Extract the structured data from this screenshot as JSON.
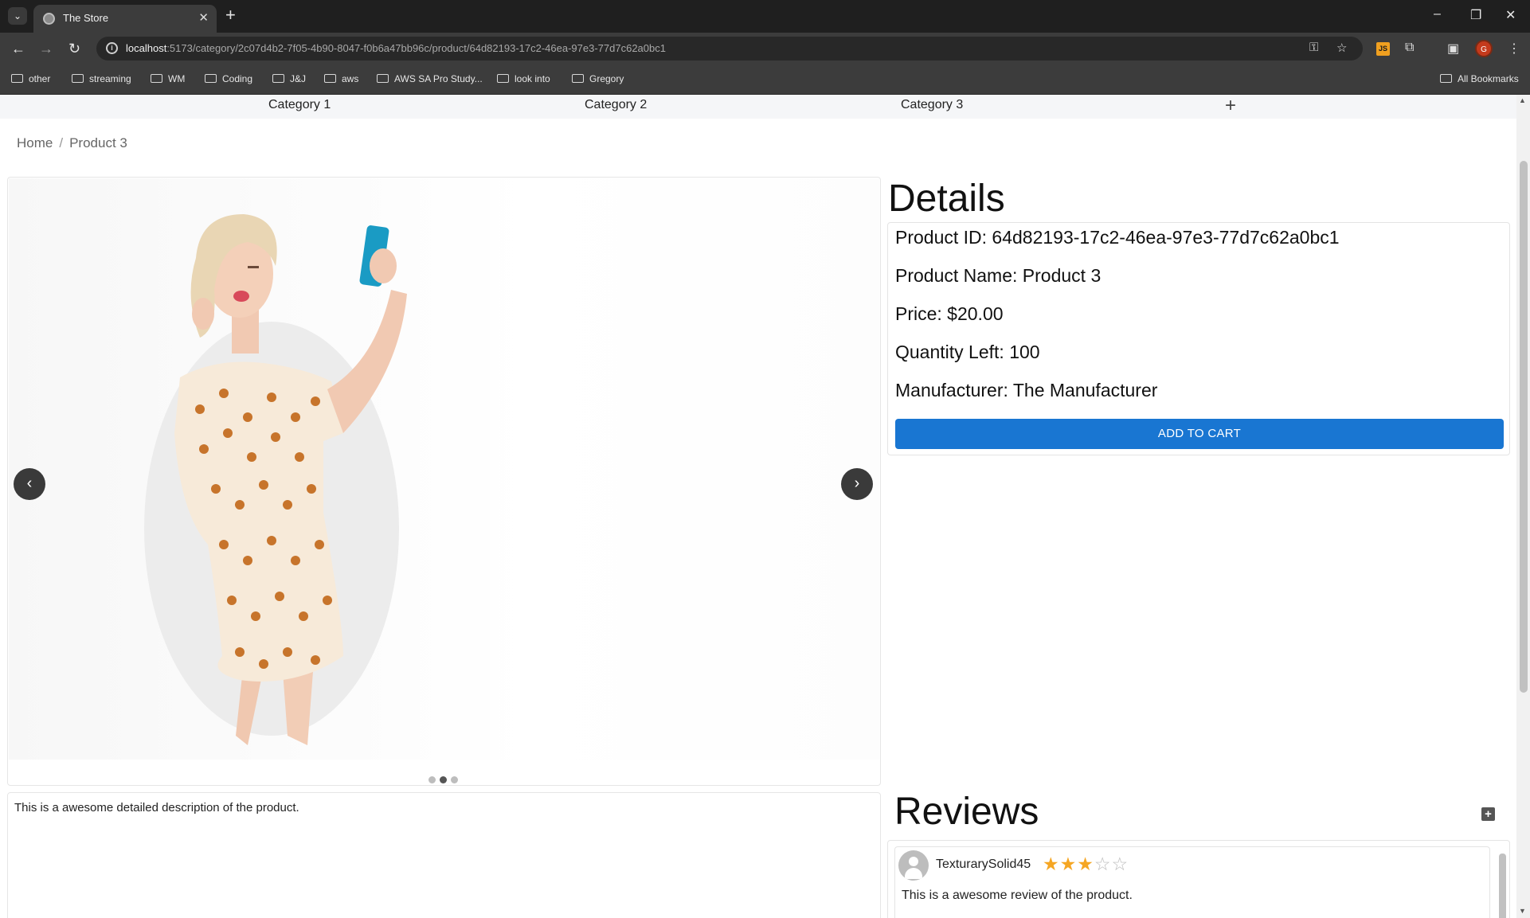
{
  "browser": {
    "tab_title": "The Store",
    "url_host": "localhost",
    "url_rest": ":5173/category/2c07d4b2-7f05-4b90-8047-f0b6a47bb96c/product/64d82193-17c2-46ea-97e3-77d7c62a0bc1",
    "profile_initial": "G",
    "ext_label": "JS",
    "bookmarks": [
      "other",
      "streaming",
      "WM",
      "Coding",
      "J&J",
      "aws",
      "AWS SA Pro Study...",
      "look into",
      "Gregory"
    ],
    "all_bookmarks": "All Bookmarks"
  },
  "nav": {
    "categories": [
      "Category 1",
      "Category 2",
      "Category 3"
    ],
    "add_icon": "plus-icon"
  },
  "breadcrumb": {
    "home": "Home",
    "separator": "/",
    "current": "Product 3"
  },
  "carousel": {
    "prev_icon": "chevron-left-icon",
    "next_icon": "chevron-right-icon",
    "slide_count": 3,
    "active_index": 1
  },
  "description": "This is a awesome detailed description of the product.",
  "details": {
    "title": "Details",
    "product_id": "Product ID: 64d82193-17c2-46ea-97e3-77d7c62a0bc1",
    "product_name": "Product Name: Product 3",
    "price": "Price: $20.00",
    "quantity": "Quantity Left: 100",
    "manufacturer": "Manufacturer: The Manufacturer",
    "add_to_cart": "ADD TO CART"
  },
  "reviews": {
    "title": "Reviews",
    "items": [
      {
        "user": "TexturarySolid45",
        "rating": 3,
        "max_rating": 5,
        "text": "This is a awesome review of the product."
      }
    ]
  },
  "colors": {
    "primary": "#1976d2",
    "star": "#f5a623",
    "chrome": "#3c3c3c"
  }
}
